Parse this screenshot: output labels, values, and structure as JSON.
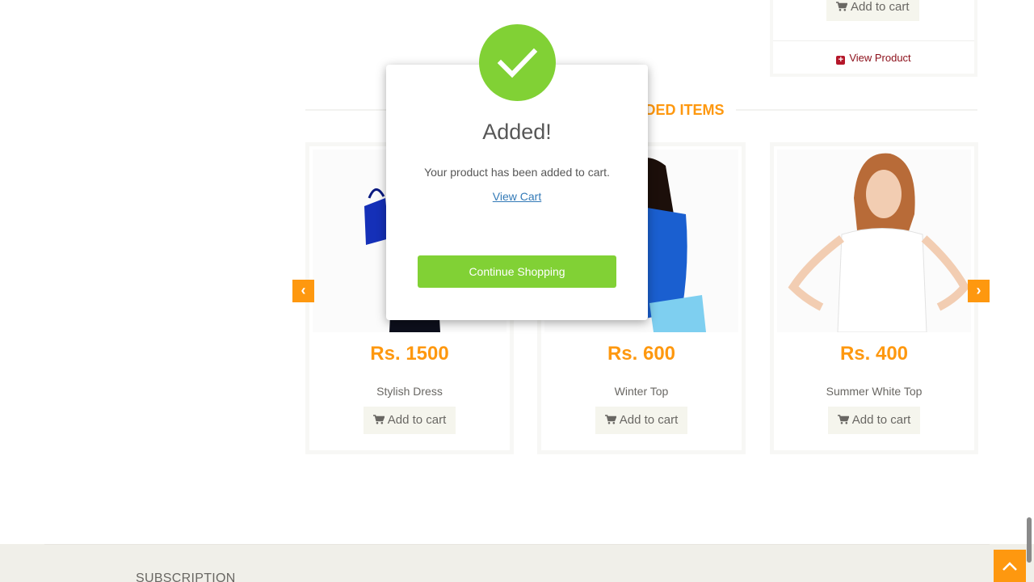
{
  "top_card": {
    "add_to_cart": "Add to cart",
    "view_product": "View Product"
  },
  "section": {
    "title": "RECOMMENDED ITEMS"
  },
  "products": [
    {
      "price": "Rs. 1500",
      "name": "Stylish Dress",
      "add_to_cart": "Add to cart"
    },
    {
      "price": "Rs. 600",
      "name": "Winter Top",
      "add_to_cart": "Add to cart"
    },
    {
      "price": "Rs. 400",
      "name": "Summer White Top",
      "add_to_cart": "Add to cart"
    }
  ],
  "carousel": {
    "prev": "‹",
    "next": "›"
  },
  "modal": {
    "title": "Added!",
    "message": "Your product has been added to cart.",
    "view_cart": "View Cart",
    "continue": "Continue Shopping"
  },
  "footer": {
    "subscription": "SUBSCRIPTION"
  },
  "colors": {
    "accent": "#fe980f",
    "success": "#81d135",
    "link": "#337ab7",
    "view_product": "#8c0f1a"
  }
}
